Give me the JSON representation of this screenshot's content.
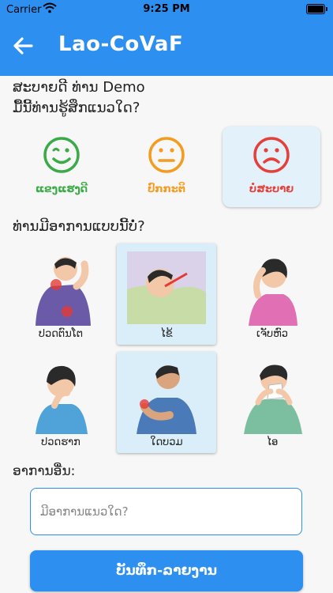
{
  "status_bar": {
    "carrier": "Carrier",
    "time": "9:25 PM"
  },
  "header": {
    "title": "Lao-CoVaF"
  },
  "greeting": "ສະບາຍດີ ທ່ານ Demo",
  "mood_question": "ມື້ນີ້ທ່ານຮູ້ສຶກແນວໃດ?",
  "moods": [
    {
      "label": "ແຂງແຮງດີ",
      "color": "#3bab48",
      "icon": "wink-smile-icon"
    },
    {
      "label": "ປົກກະຕິ",
      "color": "#f39c1f",
      "icon": "neutral-face-icon"
    },
    {
      "label": "ບໍ່ສະບາຍ",
      "color": "#e5413a",
      "icon": "sad-face-icon",
      "selected": true
    }
  ],
  "symptom_question": "ທ່ານມີອາການແບບນີ້ບໍ່?",
  "symptoms": [
    {
      "label": "ປວດຕົນໂຕ",
      "icon": "body-ache-icon"
    },
    {
      "label": "ໄຂ້",
      "icon": "fever-icon",
      "selected": true
    },
    {
      "label": "ເຈັບຫົວ",
      "icon": "headache-icon"
    },
    {
      "label": "ປວດຮາກ",
      "icon": "nausea-icon"
    },
    {
      "label": "ໃດບວມ",
      "icon": "swelling-icon",
      "selected": true
    },
    {
      "label": "ໄອ",
      "icon": "cough-icon"
    }
  ],
  "other": {
    "label": "ອາການອື່ນ:",
    "placeholder": "ມີອາການແນວໃດ?",
    "value": ""
  },
  "submit_label": "ບັນທຶກ-ລາຍງານ",
  "colors": {
    "primary": "#2d8ff0",
    "selected_bg": "#daeefa"
  }
}
